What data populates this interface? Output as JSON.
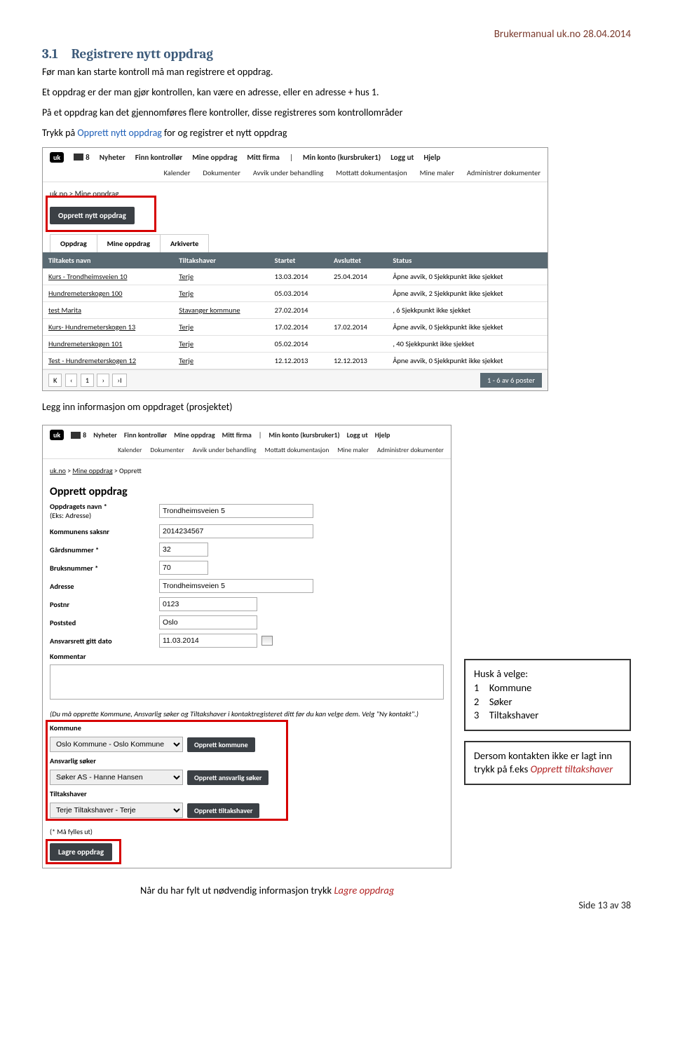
{
  "doc": {
    "header": "Brukermanual uk.no 28.04.2014",
    "section_title": "3.1 Registrere nytt oppdrag",
    "para1": "Før man kan starte kontroll må man registrere et oppdrag.",
    "para2": "Et oppdrag er der man gjør kontrollen, kan være en adresse, eller en adresse + hus 1.",
    "para3": "På et oppdrag kan det gjennomføres flere kontroller, disse registreres som kontrollområder",
    "para4_pre": "Trykk på ",
    "para4_link": "Opprett nytt oppdrag",
    "para4_post": " for og registrer et nytt oppdrag",
    "mid_caption": "Legg inn informasjon om oppdraget (prosjektet)",
    "bottom_caption_pre": "Når du har fylt ut nødvendig informasjon trykk ",
    "bottom_caption_link": "Lagre oppdrag",
    "page_footer": "Side 13 av 38"
  },
  "ss1": {
    "logo": "uk",
    "msg_count": "8",
    "nav": [
      "Nyheter",
      "Finn kontrollør",
      "Mine oppdrag",
      "Mitt firma",
      "Min konto (kursbruker1)",
      "Logg ut",
      "Hjelp"
    ],
    "subnav": [
      "Kalender",
      "Dokumenter",
      "Avvik under behandling",
      "Mottatt dokumentasjon",
      "Mine maler",
      "Administrer dokumenter"
    ],
    "crumb_home": "uk.no",
    "crumb_sep": " > ",
    "crumb_cur": "Mine oppdrag",
    "create_btn": "Opprett nytt oppdrag",
    "tabs": [
      "Oppdrag",
      "Mine oppdrag",
      "Arkiverte"
    ],
    "cols": [
      "Tiltakets navn",
      "Tiltakshaver",
      "Startet",
      "Avsluttet",
      "Status"
    ],
    "rows": [
      {
        "n": "Kurs - Trondheimsveien 10",
        "h": "Terje",
        "s": "13.03.2014",
        "a": "25.04.2014",
        "st": "Åpne avvik, 0 Sjekkpunkt ikke sjekket"
      },
      {
        "n": "Hundremeterskogen 100",
        "h": "Terje",
        "s": "05.03.2014",
        "a": "",
        "st": "Åpne avvik, 2 Sjekkpunkt ikke sjekket"
      },
      {
        "n": "test Marita",
        "h": "Stavanger kommune",
        "s": "27.02.2014",
        "a": "",
        "st": ", 6 Sjekkpunkt ikke sjekket"
      },
      {
        "n": "Kurs- Hundremeterskogen 13",
        "h": "Terje",
        "s": "17.02.2014",
        "a": "17.02.2014",
        "st": "Åpne avvik, 0 Sjekkpunkt ikke sjekket"
      },
      {
        "n": "Hundremeterskogen 101",
        "h": "Terje",
        "s": "05.02.2014",
        "a": "",
        "st": ", 40 Sjekkpunkt ikke sjekket"
      },
      {
        "n": "Test - Hundremeterskogen 12",
        "h": "Terje",
        "s": "12.12.2013",
        "a": "12.12.2013",
        "st": "Åpne avvik, 0 Sjekkpunkt ikke sjekket"
      }
    ],
    "pager": {
      "first": "K",
      "prev": "‹",
      "page": "1",
      "next": "›",
      "last": "›I",
      "count": "1 - 6 av 6 poster"
    }
  },
  "ss2": {
    "title": "Opprett oppdrag",
    "crumb_extra": "Opprett",
    "fields": {
      "navn_label": "Oppdragets navn *",
      "navn_hint": "(Eks: Adresse)",
      "navn_val": "Trondheimsveien 5",
      "saksnr_label": "Kommunens saksnr",
      "saksnr_val": "2014234567",
      "gard_label": "Gårdsnummer *",
      "gard_val": "32",
      "bruk_label": "Bruksnummer *",
      "bruk_val": "70",
      "adr_label": "Adresse",
      "adr_val": "Trondheimsveien 5",
      "postnr_label": "Postnr",
      "postnr_val": "0123",
      "poststed_label": "Poststed",
      "poststed_val": "Oslo",
      "ansvar_label": "Ansvarsrett gitt dato",
      "ansvar_val": "11.03.2014",
      "kommentar_label": "Kommentar"
    },
    "notice": "(Du må opprette Kommune, Ansvarlig søker og Tiltakshaver i kontaktregisteret ditt før du kan velge dem. Velg \"Ny kontakt\".)",
    "kommune_label": "Kommune",
    "kommune_val": "Oslo Kommune - Oslo Kommune",
    "kommune_btn": "Opprett kommune",
    "soker_label": "Ansvarlig søker",
    "soker_val": "Søker AS - Hanne Hansen",
    "soker_btn": "Opprett ansvarlig søker",
    "tiltak_label": "Tiltakshaver",
    "tiltak_val": "Terje Tiltakshaver - Terje",
    "tiltak_btn": "Opprett tiltakshaver",
    "req": "(* Må fylles ut)",
    "save_btn": "Lagre oppdrag"
  },
  "note": {
    "title": "Husk å velge:",
    "i1": "1 Kommune",
    "i2": "2 Søker",
    "i3": "3 Tiltakshaver",
    "p2a": "Dersom kontakten ikke er lagt inn trykk på f.eks ",
    "p2b": "Opprett tiltakshaver"
  }
}
